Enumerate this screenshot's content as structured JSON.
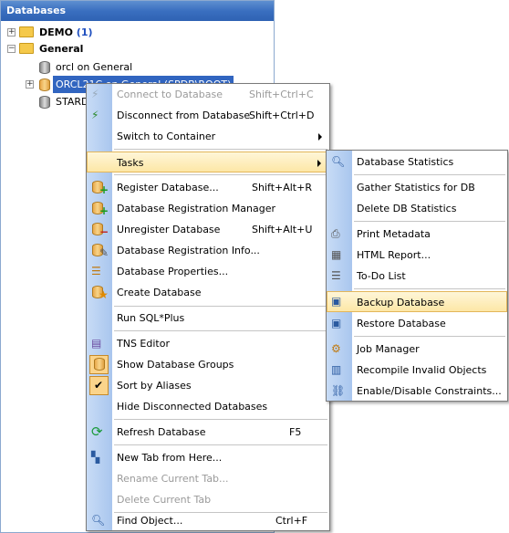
{
  "panel": {
    "title": "Databases",
    "tree": {
      "demo": {
        "label": "DEMO",
        "count": "(1)"
      },
      "general": {
        "label": "General"
      },
      "items": [
        {
          "label": "orcl on General"
        },
        {
          "label": "ORCL21C on General (SPDB\\ROOT)"
        },
        {
          "label": "STARD"
        }
      ]
    }
  },
  "context_menu": {
    "items": [
      {
        "label": "Connect to Database",
        "shortcut": "Shift+Ctrl+C"
      },
      {
        "label": "Disconnect from Database",
        "shortcut": "Shift+Ctrl+D"
      },
      {
        "label": "Switch to Container"
      },
      {
        "label": "Tasks"
      },
      {
        "label": "Register Database...",
        "shortcut": "Shift+Alt+R"
      },
      {
        "label": "Database Registration Manager"
      },
      {
        "label": "Unregister Database",
        "shortcut": "Shift+Alt+U"
      },
      {
        "label": "Database Registration Info..."
      },
      {
        "label": "Database Properties..."
      },
      {
        "label": "Create Database"
      },
      {
        "label": "Run SQL*Plus"
      },
      {
        "label": "TNS Editor"
      },
      {
        "label": "Show Database Groups"
      },
      {
        "label": "Sort by Aliases"
      },
      {
        "label": "Hide Disconnected Databases"
      },
      {
        "label": "Refresh Database",
        "shortcut": "F5"
      },
      {
        "label": "New Tab from Here..."
      },
      {
        "label": "Rename Current Tab..."
      },
      {
        "label": "Delete Current Tab"
      },
      {
        "label": "Find Object...",
        "shortcut": "Ctrl+F"
      }
    ]
  },
  "tasks_submenu": {
    "items": [
      {
        "label": "Database Statistics"
      },
      {
        "label": "Gather Statistics for DB"
      },
      {
        "label": "Delete DB Statistics"
      },
      {
        "label": "Print Metadata"
      },
      {
        "label": "HTML Report..."
      },
      {
        "label": "To-Do List"
      },
      {
        "label": "Backup Database"
      },
      {
        "label": "Restore Database"
      },
      {
        "label": "Job Manager"
      },
      {
        "label": "Recompile Invalid Objects"
      },
      {
        "label": "Enable/Disable Constraints..."
      }
    ]
  },
  "colors": {
    "title_bar": "#3a6fc0",
    "selection": "#3165c0",
    "highlight": "#fde7a6",
    "gutter": "#b8d0f2"
  }
}
